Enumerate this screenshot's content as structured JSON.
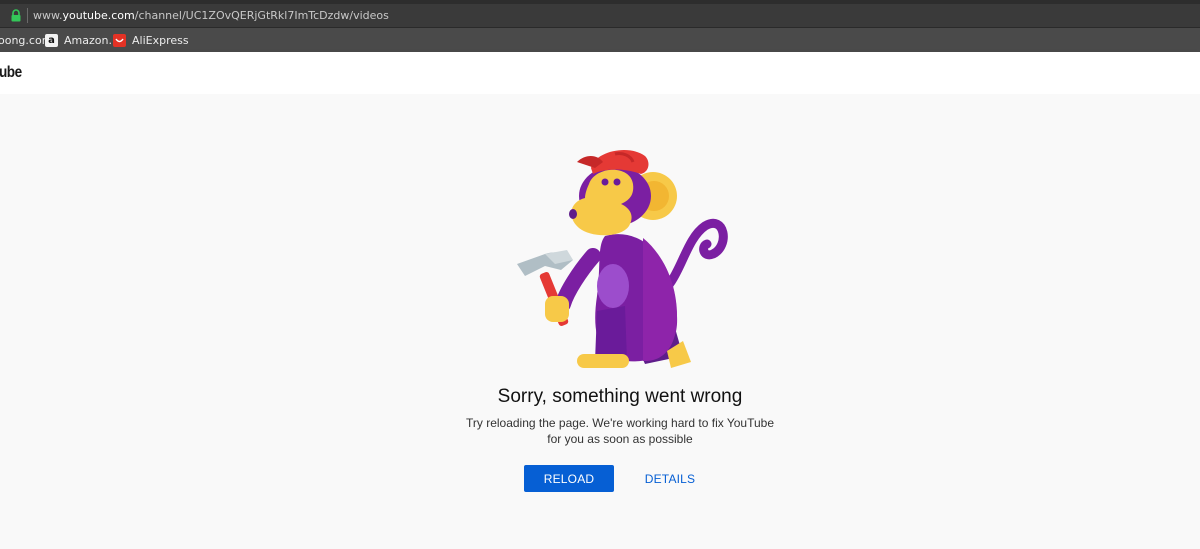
{
  "browser": {
    "url_prefix": "www.",
    "url_domain": "youtube.com",
    "url_path": "/channel/UC1ZOvQERjGtRkl7ImTcDzdw/videos",
    "bookmarks": [
      {
        "label": "oong.com",
        "icon": "site-icon"
      },
      {
        "label": "Amazon.in",
        "icon": "amazon-icon"
      },
      {
        "label": "AliExpress",
        "icon": "aliexpress-icon"
      }
    ]
  },
  "header": {
    "logo_text": "ube"
  },
  "error": {
    "title": "Sorry, something went wrong",
    "message": "Try reloading the page. We're working hard to fix YouTube for you as soon as possible",
    "reload_label": "RELOAD",
    "details_label": "DETAILS"
  },
  "colors": {
    "primary_blue": "#065fd4",
    "monkey_purple": "#6a1b9a",
    "monkey_face": "#f7c948",
    "cap_red": "#e53935"
  }
}
